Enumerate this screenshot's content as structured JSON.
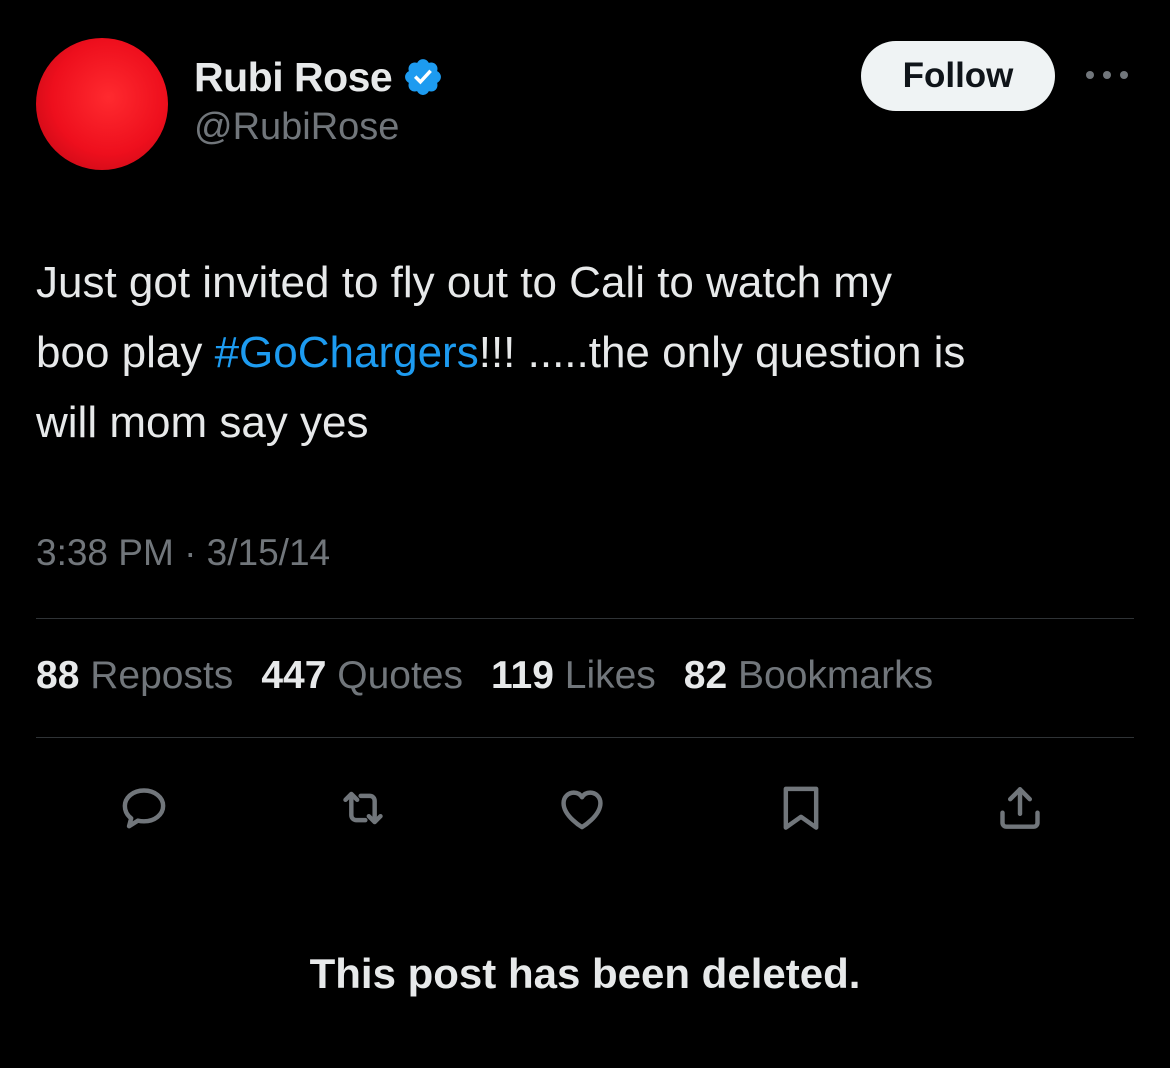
{
  "author": {
    "display_name": "Rubi Rose",
    "handle": "@RubiRose",
    "verified": true,
    "avatar_color": "#ee0f1d"
  },
  "header": {
    "follow_label": "Follow",
    "more_icon": "more-horizontal-icon"
  },
  "tweet": {
    "text_line1": "Just got invited to fly out to Cali to watch my",
    "text_line2_prefix": "boo play ",
    "hashtag": "#GoChargers",
    "text_line2_suffix": "!!! .....the only question is",
    "text_line3": "will mom say yes",
    "hashtag_color": "#1d9bf0",
    "timestamp": "3:38 PM · 3/15/14"
  },
  "stats": {
    "reposts_count": "88",
    "reposts_label": "Reposts",
    "quotes_count": "447",
    "quotes_label": "Quotes",
    "likes_count": "119",
    "likes_label": "Likes",
    "bookmarks_count": "82",
    "bookmarks_label": "Bookmarks"
  },
  "actions": [
    "reply-icon",
    "repost-icon",
    "like-icon",
    "bookmark-icon",
    "share-icon"
  ],
  "notice": {
    "deleted_text": "This post has been deleted."
  },
  "colors": {
    "background": "#000000",
    "primary_text": "#e7e9ea",
    "secondary_text": "#71767b",
    "divider": "#2f3336",
    "verified_badge": "#1d9bf0"
  }
}
